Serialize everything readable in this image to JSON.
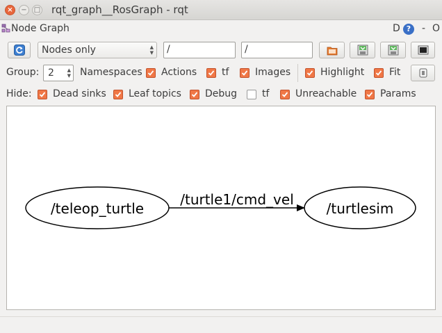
{
  "window": {
    "title": "rqt_graph__RosGraph - rqt",
    "close_glyph": "×",
    "minimize_glyph": "−",
    "maximize_glyph": "□"
  },
  "dock": {
    "title": "Node Graph",
    "d_label": "D",
    "help_glyph": "?",
    "minimize_glyph": "-",
    "close_glyph": "O"
  },
  "toolbar": {
    "refresh_icon": "refresh-icon",
    "mode": "Nodes only",
    "node_filter": "/",
    "topic_filter": "/",
    "load_icon": "folder-icon",
    "save_dot_icon": "save-dot-icon",
    "save_svg_icon": "save-svg-icon",
    "screenshot_icon": "screenshot-icon"
  },
  "group_row": {
    "group_label": "Group:",
    "group_value": "2",
    "options": [
      {
        "label": "Namespaces",
        "checked": true
      },
      {
        "label": "Actions",
        "checked": true
      },
      {
        "label": "tf",
        "checked": true
      },
      {
        "label": "Images",
        "checked": true
      },
      {
        "label": "Highlight",
        "checked": true
      },
      {
        "label": "Fit",
        "checked": true
      }
    ]
  },
  "hide_row": {
    "hide_label": "Hide:",
    "options": [
      {
        "label": "Dead sinks",
        "checked": true
      },
      {
        "label": "Leaf topics",
        "checked": true
      },
      {
        "label": "Debug",
        "checked": true
      },
      {
        "label": "tf",
        "checked": false
      },
      {
        "label": "Unreachable",
        "checked": true
      },
      {
        "label": "Params",
        "checked": true
      }
    ]
  },
  "graph": {
    "nodes": [
      {
        "label": "/teleop_turtle"
      },
      {
        "label": "/turtlesim"
      }
    ],
    "edges": [
      {
        "from": "/teleop_turtle",
        "to": "/turtlesim",
        "label": "/turtle1/cmd_vel"
      }
    ]
  },
  "colors": {
    "checkbox_fill": "#f07746",
    "close_button": "#e8673c",
    "canvas_background": "#ffffff"
  }
}
